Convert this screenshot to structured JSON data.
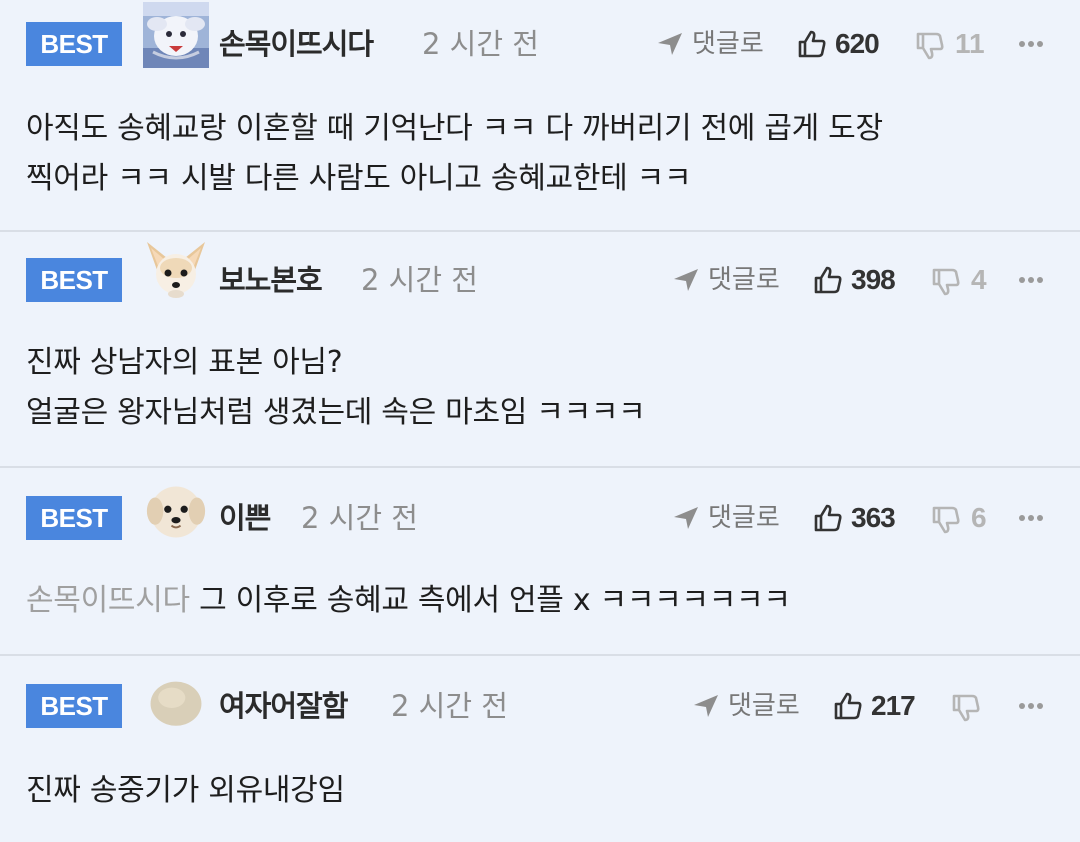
{
  "reply_label": "댓글로",
  "colors": {
    "badge": "#4a86de",
    "background": "#eef3fb",
    "divider": "#d9dee6"
  },
  "comments": [
    {
      "badge": "BEST",
      "nickname": "손목이뜨시다",
      "time": "2 시간 전",
      "likes": "620",
      "dislikes": "11",
      "avatar": "icy-creature-avatar",
      "lines": [
        "아직도 송혜교랑 이혼할 때 기억난다 ㅋㅋ 다 까버리기 전에 곱게 도장",
        "찍어라 ㅋㅋ 시발 다른 사람도 아니고 송혜교한테 ㅋㅋ"
      ]
    },
    {
      "badge": "BEST",
      "nickname": "보노본호",
      "time": "2 시간 전",
      "likes": "398",
      "dislikes": "4",
      "avatar": "chihuahua-avatar",
      "lines": [
        "진짜 상남자의 표본 아님?",
        "얼굴은 왕자님처럼 생겼는데 속은 마초임 ㅋㅋㅋㅋ"
      ]
    },
    {
      "badge": "BEST",
      "nickname": "이쁜",
      "time": "2 시간 전",
      "likes": "363",
      "dislikes": "6",
      "avatar": "puppy-avatar",
      "mention": "손목이뜨시다",
      "lines": [
        "그 이후로 송혜교 측에서 언플 x ㅋㅋㅋㅋㅋㅋㅋ"
      ]
    },
    {
      "badge": "BEST",
      "nickname": "여자어잘함",
      "time": "2 시간 전",
      "likes": "217",
      "dislikes": "",
      "avatar": "blob-avatar",
      "lines": [
        "진짜 송중기가 외유내강임"
      ]
    }
  ]
}
